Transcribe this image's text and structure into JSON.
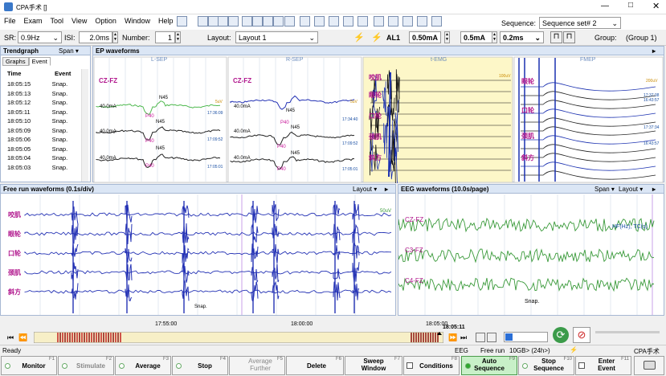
{
  "window": {
    "title": "CPA手术 []"
  },
  "menu": [
    "File",
    "Exam",
    "Tool",
    "View",
    "Option",
    "Window",
    "Help"
  ],
  "sequence": {
    "label": "Sequence:",
    "value": "Sequence set# 2"
  },
  "settings": {
    "sr_label": "SR:",
    "sr_value": "0.9Hz",
    "isi_label": "ISI:",
    "isi_value": "2.0ms",
    "number_label": "Number:",
    "number_value": "1",
    "layout_label": "Layout:",
    "layout_value": "Layout 1",
    "al": "AL1",
    "current1": "0.50mA",
    "current2": "0.5mA",
    "duration": "0.2ms",
    "group_label": "Group:",
    "group_value": "(Group 1)"
  },
  "trend": {
    "title": "Trendgraph",
    "span": "Span ▾",
    "tabs": [
      "Graphs",
      "Event"
    ],
    "cols": [
      "Time",
      "Event"
    ],
    "rows": [
      [
        "18:05:15",
        "Snap."
      ],
      [
        "18:05:13",
        "Snap."
      ],
      [
        "18:05:12",
        "Snap."
      ],
      [
        "18:05:11",
        "Snap."
      ],
      [
        "18:05:10",
        "Snap."
      ],
      [
        "18:05:09",
        "Snap."
      ],
      [
        "18:05:06",
        "Snap."
      ],
      [
        "18:05:05",
        "Snap."
      ],
      [
        "18:05:04",
        "Snap."
      ],
      [
        "18:05:03",
        "Snap."
      ]
    ]
  },
  "ep": {
    "title": "EP waveforms",
    "panels": [
      "L-SEP",
      "R-SEP",
      "t-EMG",
      "FMEP"
    ],
    "lsep": {
      "ch": "CZ-FZ",
      "n": "N45",
      "p": "P40",
      "ma": "40.0mA",
      "times": [
        "17:36:09",
        "17:09:52",
        "17:05:01"
      ],
      "scale": "5uV"
    },
    "rsep": {
      "ch": "CZ-FZ",
      "n": "N45",
      "p": "P40",
      "ma": "40.0mA",
      "times": [
        "17:34:40",
        "17:09:52",
        "17:05:01"
      ],
      "scale": "5uV"
    },
    "emg": {
      "labels": [
        "咬肌",
        "眼轮",
        "口轮",
        "颈肌",
        "斜方"
      ],
      "scale": "100uV"
    },
    "fmep": {
      "labels": [
        "眼轮",
        "口轮",
        "颈肌",
        "斜方"
      ],
      "scale": "200uV",
      "times": [
        "17:37:38",
        "16:43:57",
        "17:37:34",
        "16:43:57"
      ]
    }
  },
  "freerun": {
    "title": "Free run waveforms  (0.1s/div)",
    "layout": "Layout ▾",
    "labels": [
      "咬肌",
      "眼轮",
      "口轮",
      "颈肌",
      "斜方"
    ],
    "scale": "50uV",
    "snap": "Snap."
  },
  "eeg": {
    "title": "EEG waveforms  (10.0s/page)",
    "span": "Span ▾",
    "layout": "Layout ▾",
    "labels": [
      "CZ-FZ",
      "C3-FZ",
      "C4-FZ"
    ],
    "note": "HF(Hz), TC(s)",
    "snap": "Snap."
  },
  "timeline": {
    "t1": "17:55:00",
    "t2": "18:00:00",
    "t3": "18:05:00",
    "cursor": "18:05:11"
  },
  "status": {
    "left": "Ready",
    "eeg": "EEG",
    "mode": "Free run",
    "disk": "10GB> (24h>)",
    "app": "CPA手术"
  },
  "fkeys": [
    {
      "n": "F1",
      "label": "Monitor"
    },
    {
      "n": "F2",
      "label": "Stimulate"
    },
    {
      "n": "F3",
      "label": "Average"
    },
    {
      "n": "F4",
      "label": "Stop"
    },
    {
      "n": "F5",
      "label": "Average Further"
    },
    {
      "n": "F6",
      "label": "Delete"
    },
    {
      "n": "F7",
      "label": "Sweep Window"
    },
    {
      "n": "F8",
      "label": "Conditions"
    },
    {
      "n": "F9",
      "label": "Auto Sequence"
    },
    {
      "n": "F10",
      "label": "Stop Sequence"
    },
    {
      "n": "F11",
      "label": "Enter Event"
    }
  ]
}
